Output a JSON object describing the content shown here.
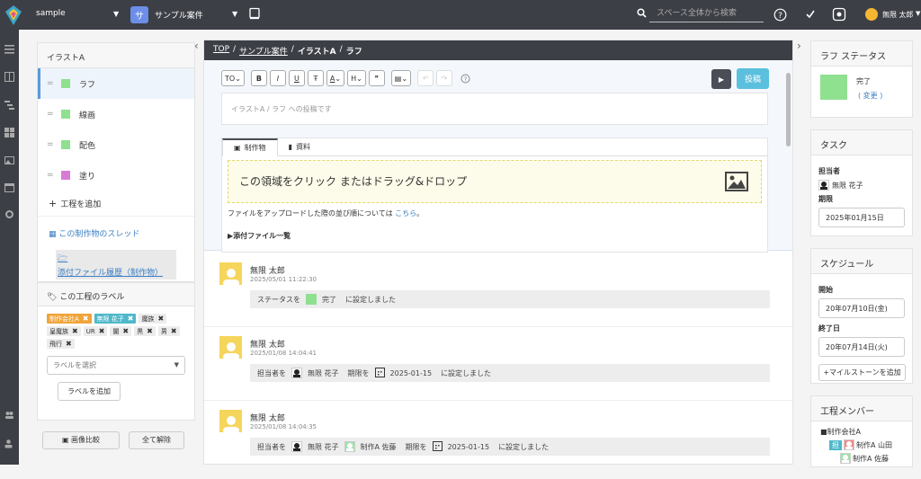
{
  "topbar": {
    "workspace": "sample",
    "project_badge": "サ",
    "project": "サンプル案件",
    "search_placeholder": "スペース全体から検索",
    "user": "無限 太郎"
  },
  "breadcrumb": {
    "top": "TOP",
    "project": "サンプル案件",
    "illust": "イラストA",
    "current": "ラフ"
  },
  "sidebar": {
    "title": "イラストA",
    "steps": [
      {
        "label": "ラフ",
        "color": "#8fe08f"
      },
      {
        "label": "線画",
        "color": "#8fe08f"
      },
      {
        "label": "配色",
        "color": "#8fe08f"
      },
      {
        "label": "塗り",
        "color": "#d97ad6"
      }
    ],
    "add_step": "工程を追加",
    "thread_link": "この制作物のスレッド",
    "history_link": "添付ファイル履歴（制作物）",
    "labels_title": "この工程のラベル",
    "tags": [
      {
        "text": "制作会社A",
        "kind": "orange"
      },
      {
        "text": "無限 花子",
        "kind": "teal"
      },
      {
        "text": "魔族",
        "kind": "gray"
      },
      {
        "text": "皇魔族",
        "kind": "gray"
      },
      {
        "text": "UR",
        "kind": "gray"
      },
      {
        "text": "闇",
        "kind": "gray"
      },
      {
        "text": "黒",
        "kind": "gray"
      },
      {
        "text": "男",
        "kind": "gray"
      },
      {
        "text": "飛行",
        "kind": "gray"
      }
    ],
    "label_select_placeholder": "ラベルを選択",
    "label_add": "ラベルを追加",
    "compare": "画像比較",
    "clear_all": "全て解除"
  },
  "editor": {
    "toolbar": {
      "size": "TO",
      "bold": "B",
      "italic": "I",
      "underline": "U",
      "strike": "Ŧ",
      "color": "A",
      "heading": "H",
      "quote": "❞"
    },
    "post_button": "投稿",
    "placeholder": "イラストA / ラフ への投稿です",
    "tab_product": "制作物",
    "tab_material": "資料",
    "drop_text": "この領域をクリック またはドラッグ&ドロップ",
    "upload_note": "ファイルをアップロードした際の並び順については",
    "upload_link": "こちら",
    "upload_note_end": "。",
    "attach_list": "添付ファイル一覧"
  },
  "feed": [
    {
      "name": "無限 太郎",
      "time": "2025/05/01 11:22:30",
      "p1": "ステータスを",
      "status": "完了",
      "end": "に設定しました"
    },
    {
      "name": "無限 太郎",
      "time": "2025/01/08 14:04:41",
      "p1": "担当者を",
      "person": "無限 花子",
      "p2": "期限を",
      "date": "2025-01-15",
      "end": "に設定しました"
    },
    {
      "name": "無限 太郎",
      "time": "2025/01/08 14:04:35",
      "p1": "担当者を",
      "person": "無限 花子",
      "person2": "制作A 佐藤",
      "p2": "期限を",
      "date": "2025-01-15",
      "end": "に設定しました"
    }
  ],
  "right": {
    "status_title": "ラフ ステータス",
    "status_value": "完了",
    "status_change": "( 変更 )",
    "task_title": "タスク",
    "assignee_label": "担当者",
    "assignee": "無限 花子",
    "due_label": "期限",
    "due": "2025年01月15日",
    "schedule_title": "スケジュール",
    "start_label": "開始",
    "start": "20年07月10日(金)",
    "end_label": "終了日",
    "end": "20年07月14日(火)",
    "milestone": "マイルストーンを追加",
    "members_title": "工程メンバー",
    "company": "■制作会社A",
    "member_badge": "担",
    "member1": "制作A 山田",
    "member2": "制作A 佐藤"
  },
  "colors": {
    "topbar": "#3d3f46",
    "accent": "#5bc0de",
    "done": "#8fe08f"
  }
}
